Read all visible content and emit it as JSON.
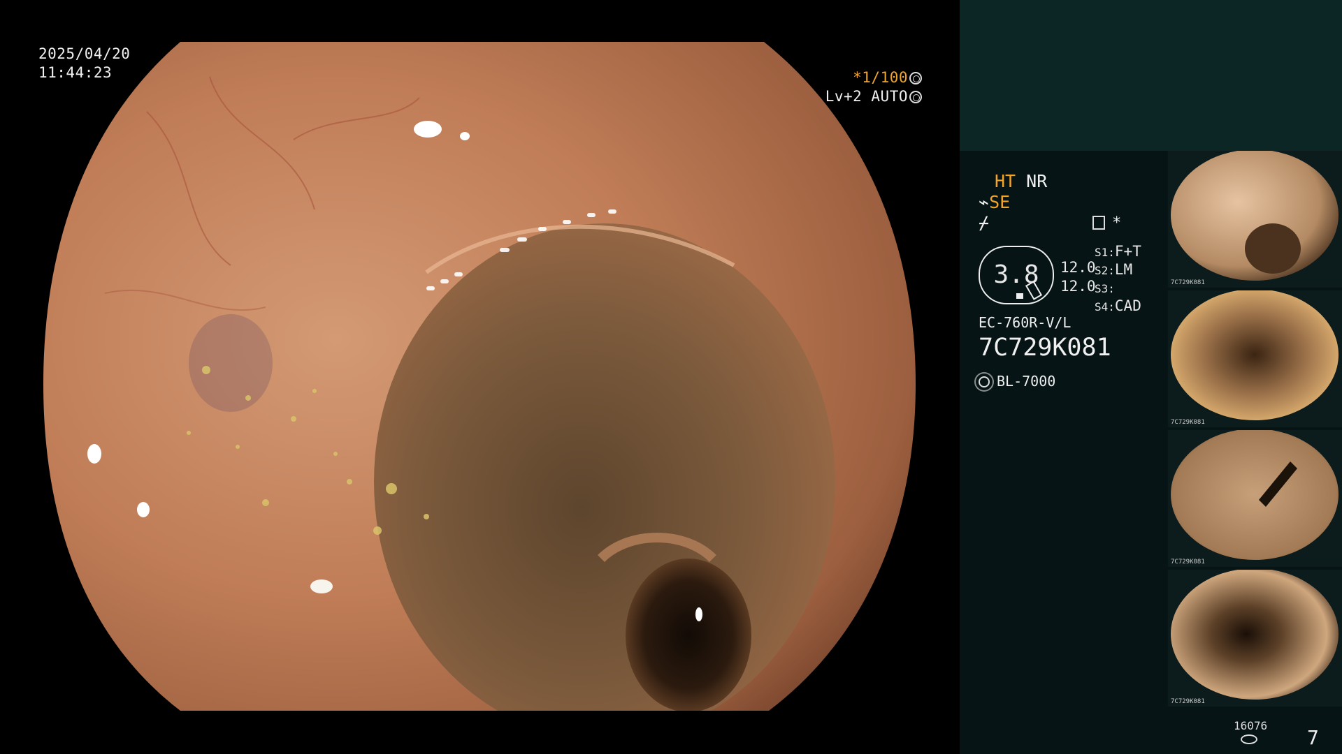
{
  "overlay": {
    "date": "2025/04/20",
    "time": "11:44:23",
    "shutter": "*1/100",
    "exposure": "Lv+2 AUTO"
  },
  "settings": {
    "ht": "HT",
    "nr": "NR",
    "se": "SE",
    "level": "3.8",
    "gain_top": "12.0",
    "gain_bottom": "12.0",
    "switches": [
      {
        "key": "S1:",
        "value": "F+T"
      },
      {
        "key": "S2:",
        "value": "LM"
      },
      {
        "key": "S3:",
        "value": ""
      },
      {
        "key": "S4:",
        "value": "CAD"
      }
    ],
    "asterisk": "*",
    "model": "EC-760R-V/L",
    "serial": "7C729K081",
    "light_source": "BL-7000"
  },
  "thumbnails": [
    {
      "caption": "7C729K081"
    },
    {
      "caption": "7C729K081"
    },
    {
      "caption": "7C729K081"
    },
    {
      "caption": "7C729K081"
    }
  ],
  "footer": {
    "count": "16076",
    "page": "7"
  },
  "colors": {
    "accent": "#f3a52a",
    "panel_dark": "#071415",
    "panel_top": "#0c2525"
  }
}
